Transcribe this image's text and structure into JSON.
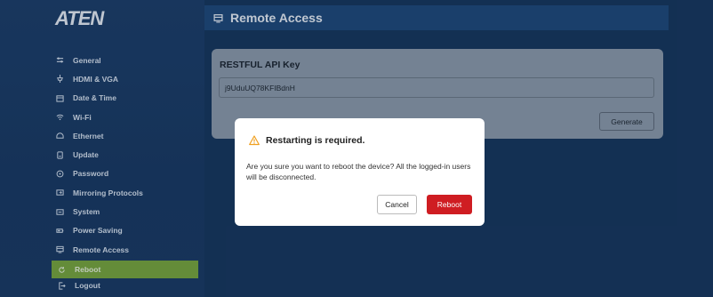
{
  "brand": {
    "logo": "ATEN"
  },
  "sidebar": {
    "items": [
      {
        "label": "General",
        "icon": "sliders-icon"
      },
      {
        "label": "HDMI & VGA",
        "icon": "hdmi-icon"
      },
      {
        "label": "Date & Time",
        "icon": "calendar-icon"
      },
      {
        "label": "Wi-Fi",
        "icon": "wifi-icon"
      },
      {
        "label": "Ethernet",
        "icon": "ethernet-icon"
      },
      {
        "label": "Update",
        "icon": "update-icon"
      },
      {
        "label": "Password",
        "icon": "lock-icon"
      },
      {
        "label": "Mirroring Protocols",
        "icon": "mirror-icon"
      },
      {
        "label": "System",
        "icon": "system-icon"
      },
      {
        "label": "Power Saving",
        "icon": "battery-icon"
      },
      {
        "label": "Remote Access",
        "icon": "remote-icon"
      }
    ],
    "reboot": {
      "label": "Reboot",
      "icon": "refresh-icon"
    },
    "logout": {
      "label": "Logout",
      "icon": "logout-icon"
    }
  },
  "header": {
    "title": "Remote Access",
    "icon": "remote-icon"
  },
  "card": {
    "title": "RESTFUL API Key",
    "api_key": "j9UduUQ78KFIBdnH",
    "generate_label": "Generate"
  },
  "dialog": {
    "title": "Restarting is required.",
    "message": "Are you sure you want to reboot the device? All the logged-in users will be disconnected.",
    "cancel_label": "Cancel",
    "reboot_label": "Reboot",
    "icon": "warning-icon"
  },
  "colors": {
    "background": "#17375f",
    "active_nav": "#79a83f",
    "reboot_button": "#cf1d22",
    "warning": "#f0a020"
  }
}
